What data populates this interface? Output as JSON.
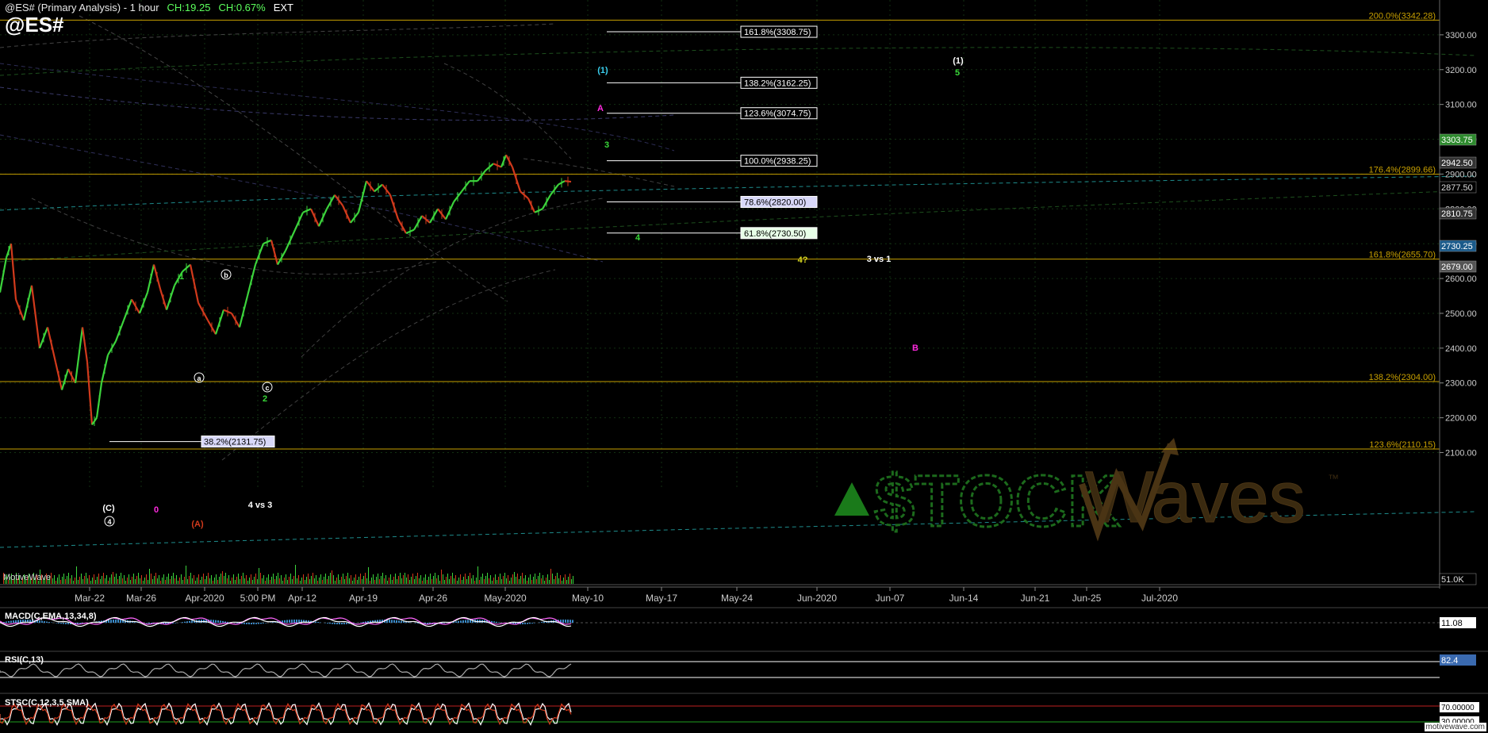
{
  "header": {
    "title": "@ES# (Primary Analysis) - 1 hour",
    "change": "CH:19.25",
    "change_pct": "CH:0.67%",
    "session": "EXT",
    "symbol": "@ES#"
  },
  "watermark": {
    "stock_text": "$TOCK",
    "waves_text": "Waves",
    "tm": "™",
    "source": "MotiveWave",
    "site": "motivewave.com"
  },
  "colors": {
    "bg": "#000000",
    "up": "#3cd43c",
    "down": "#d23a1c",
    "fib": "#c8a000",
    "teal": "#1e8c8c",
    "grid": "#1a3a1a"
  },
  "chart_data": [
    {
      "type": "line",
      "title": "@ES# (Primary Analysis) - 1 hour",
      "ylim": [
        2010,
        3400
      ],
      "y_ticks": [
        2100,
        2200,
        2300,
        2400,
        2500,
        2600,
        2700,
        2800,
        2900,
        3000,
        3100,
        3200,
        3300
      ],
      "x_ticks": [
        "Mar-22",
        "Mar-26",
        "Apr-2020",
        "5:00 PM",
        "Apr-12",
        "Apr-19",
        "Apr-26",
        "May-2020",
        "May-10",
        "May-17",
        "May-24",
        "Jun-2020",
        "Jun-07",
        "Jun-14",
        "Jun-21",
        "Jun-25",
        "Jul-2020"
      ],
      "price_path": [
        [
          0,
          2560
        ],
        [
          8,
          2660
        ],
        [
          14,
          2700
        ],
        [
          20,
          2540
        ],
        [
          30,
          2480
        ],
        [
          40,
          2580
        ],
        [
          50,
          2400
        ],
        [
          60,
          2460
        ],
        [
          70,
          2360
        ],
        [
          78,
          2280
        ],
        [
          86,
          2340
        ],
        [
          95,
          2300
        ],
        [
          104,
          2460
        ],
        [
          110,
          2360
        ],
        [
          116,
          2180
        ],
        [
          122,
          2200
        ],
        [
          128,
          2300
        ],
        [
          136,
          2380
        ],
        [
          146,
          2420
        ],
        [
          156,
          2480
        ],
        [
          166,
          2540
        ],
        [
          176,
          2500
        ],
        [
          186,
          2560
        ],
        [
          194,
          2640
        ],
        [
          202,
          2570
        ],
        [
          210,
          2510
        ],
        [
          220,
          2580
        ],
        [
          230,
          2620
        ],
        [
          240,
          2640
        ],
        [
          250,
          2530
        ],
        [
          262,
          2480
        ],
        [
          272,
          2440
        ],
        [
          282,
          2510
        ],
        [
          292,
          2500
        ],
        [
          302,
          2460
        ],
        [
          312,
          2550
        ],
        [
          322,
          2640
        ],
        [
          332,
          2700
        ],
        [
          342,
          2710
        ],
        [
          350,
          2640
        ],
        [
          360,
          2680
        ],
        [
          372,
          2740
        ],
        [
          382,
          2790
        ],
        [
          392,
          2800
        ],
        [
          402,
          2750
        ],
        [
          412,
          2800
        ],
        [
          422,
          2840
        ],
        [
          432,
          2810
        ],
        [
          442,
          2760
        ],
        [
          452,
          2790
        ],
        [
          462,
          2880
        ],
        [
          472,
          2850
        ],
        [
          482,
          2870
        ],
        [
          492,
          2840
        ],
        [
          502,
          2770
        ],
        [
          512,
          2730
        ],
        [
          522,
          2740
        ],
        [
          532,
          2780
        ],
        [
          542,
          2760
        ],
        [
          552,
          2800
        ],
        [
          562,
          2770
        ],
        [
          572,
          2820
        ],
        [
          582,
          2850
        ],
        [
          592,
          2880
        ],
        [
          602,
          2880
        ],
        [
          612,
          2910
        ],
        [
          622,
          2930
        ],
        [
          632,
          2920
        ],
        [
          638,
          2955
        ],
        [
          646,
          2920
        ],
        [
          656,
          2850
        ],
        [
          666,
          2830
        ],
        [
          674,
          2790
        ],
        [
          684,
          2800
        ],
        [
          694,
          2840
        ],
        [
          704,
          2870
        ],
        [
          712,
          2880
        ],
        [
          720,
          2878
        ]
      ],
      "price_labels": [
        "3303.75",
        "2942.50",
        "2877.50",
        "2810.75",
        "2730.25",
        "2679.00",
        "51.0K"
      ],
      "horizontal_levels": [
        {
          "label": "200.0%(3342.28)",
          "value": 3342.28
        },
        {
          "label": "176.4%(2899.66)",
          "value": 2899.66
        },
        {
          "label": "161.8%(2655.70)",
          "value": 2655.7
        },
        {
          "label": "138.2%(2304.00)",
          "value": 2304.0
        },
        {
          "label": "123.6%(2110.15)",
          "value": 2110.15
        }
      ],
      "fib_targets": [
        {
          "label": "161.8%(3308.75)",
          "value": 3308.75
        },
        {
          "label": "138.2%(3162.25)",
          "value": 3162.25
        },
        {
          "label": "123.6%(3074.75)",
          "value": 3074.75
        },
        {
          "label": "100.0%(2938.25)",
          "value": 2938.25
        },
        {
          "label": "78.6%(2820.00)",
          "value": 2820.0
        },
        {
          "label": "61.8%(2730.50)",
          "value": 2730.5
        }
      ],
      "left_fib": {
        "label": "38.2%(2131.75)",
        "value": 2131.75
      },
      "wave_labels": [
        {
          "text": "(1)",
          "color": "#3ad0f0"
        },
        {
          "text": "A",
          "color": "#ff2adf"
        },
        {
          "text": "3",
          "color": "#39d839"
        },
        {
          "text": "4",
          "color": "#39d839"
        },
        {
          "text": "4?",
          "color": "#d8d820"
        },
        {
          "text": "3 vs 1",
          "color": "#ffffff"
        },
        {
          "text": "(1)",
          "color": "#ffffff"
        },
        {
          "text": "5",
          "color": "#39d839"
        },
        {
          "text": "B",
          "color": "#ff2adf"
        },
        {
          "text": "1",
          "color": "#39d839"
        },
        {
          "text": "b",
          "color": "#ffffff"
        },
        {
          "text": "a",
          "color": "#ffffff"
        },
        {
          "text": "c",
          "color": "#ffffff"
        },
        {
          "text": "2",
          "color": "#39d839"
        },
        {
          "text": "(C)",
          "color": "#ffffff"
        },
        {
          "text": "4",
          "color": "#ffffff"
        },
        {
          "text": "0",
          "color": "#ff2adf"
        },
        {
          "text": "4 vs 3",
          "color": "#ffffff"
        },
        {
          "text": "(A)",
          "color": "#d23a1c"
        }
      ]
    },
    {
      "type": "line",
      "title": "MACD(C,EMA,13,34,8)",
      "value_label": "11.08"
    },
    {
      "type": "line",
      "title": "RSI(C,13)",
      "value_label": "82.4",
      "levels": [
        70,
        30
      ]
    },
    {
      "type": "line",
      "title": "STSC(C,12,3,5,SMA)",
      "levels": [
        "70.00000",
        "30.00000"
      ]
    }
  ]
}
